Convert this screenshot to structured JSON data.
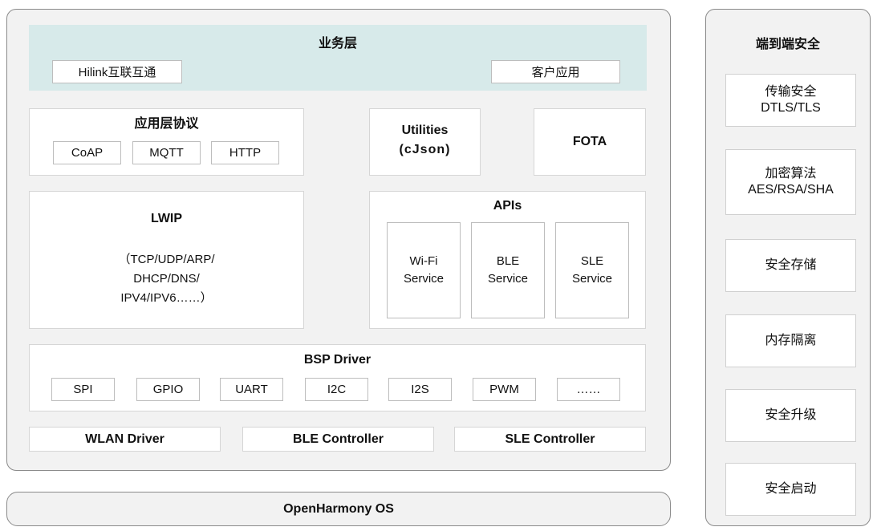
{
  "main_stack": {
    "business_layer": {
      "title": "业务层",
      "items": [
        "Hilink互联互通",
        "客户应用"
      ]
    },
    "app_protocol": {
      "title": "应用层协议",
      "items": [
        "CoAP",
        "MQTT",
        "HTTP"
      ]
    },
    "utilities": {
      "line1": "Utilities",
      "line2": "(cJson)"
    },
    "fota": "FOTA",
    "lwip": {
      "title": "LWIP",
      "detail": "（TCP/UDP/ARP/\nDHCP/DNS/\nIPV4/IPV6……）"
    },
    "apis": {
      "title": "APIs",
      "items": [
        "Wi-Fi\nService",
        "BLE\nService",
        "SLE\nService"
      ]
    },
    "bsp_driver": {
      "title": "BSP Driver",
      "items": [
        "SPI",
        "GPIO",
        "UART",
        "I2C",
        "I2S",
        "PWM",
        "……"
      ]
    },
    "drivers": [
      "WLAN Driver",
      "BLE Controller",
      "SLE Controller"
    ]
  },
  "os": "OpenHarmony OS",
  "security": {
    "title": "端到端安全",
    "items": [
      "传输安全\nDTLS/TLS",
      "加密算法\nAES/RSA/SHA",
      "安全存储",
      "内存隔离",
      "安全升级",
      "安全启动"
    ]
  },
  "colors": {
    "business_layer_bg": "#d7eaea",
    "panel_bg": "#f2f2f2",
    "border": "#8a8a8a"
  }
}
